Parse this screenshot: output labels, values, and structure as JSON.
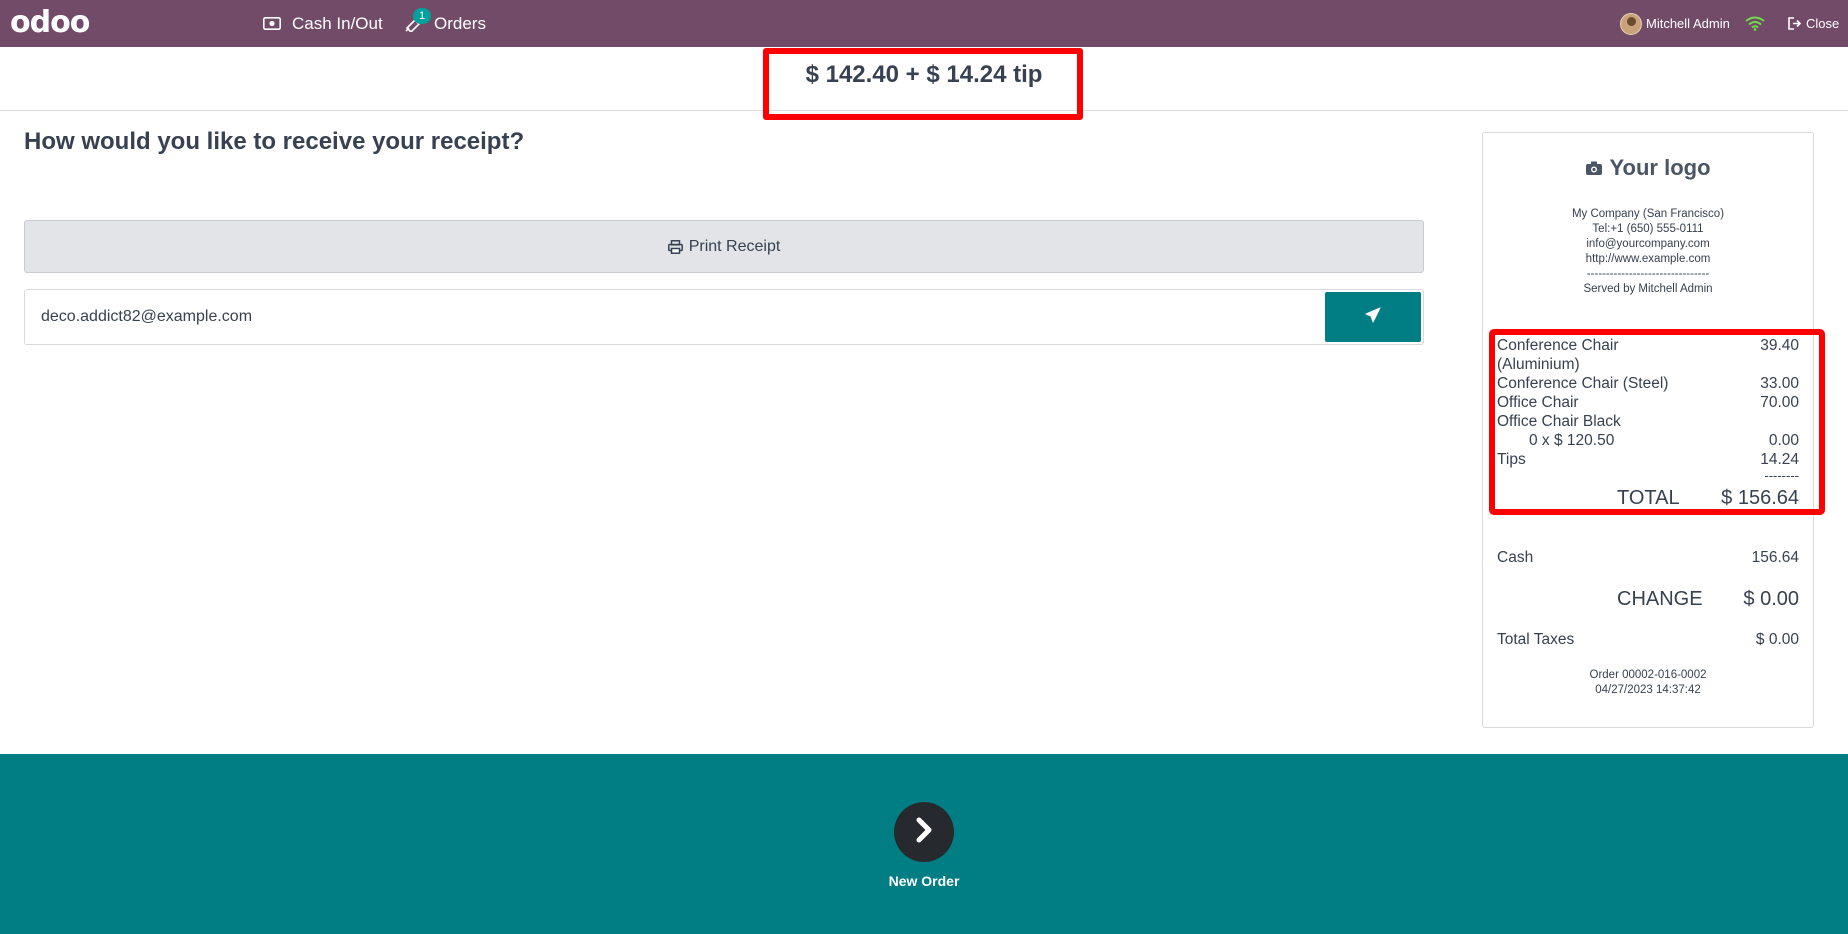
{
  "navbar": {
    "logo": "odoo",
    "cash_label": "Cash In/Out",
    "orders_label": "Orders",
    "orders_badge": "1",
    "user_name": "Mitchell Admin",
    "close_label": "Close",
    "icons": [
      "cash-icon",
      "orders-icon",
      "wifi-icon",
      "sign-out-icon"
    ]
  },
  "amount": {
    "text": "$ 142.40 + $ 14.24 tip"
  },
  "main": {
    "question": "How would you like to receive your receipt?",
    "print_label": "Print Receipt",
    "email_value": "deco.addict82@example.com"
  },
  "receipt": {
    "logo_text": "Your logo",
    "company": "My Company (San Francisco)",
    "tel": "Tel:+1 (650) 555-0111",
    "email": "info@yourcompany.com",
    "website": "http://www.example.com",
    "separator": "--------------------------------",
    "served_by": "Served by Mitchell Admin",
    "lines": [
      {
        "name": "Conference Chair",
        "price": "39.40"
      },
      {
        "name": "(Aluminium)",
        "price": ""
      },
      {
        "name": "Conference Chair (Steel)",
        "price": "33.00"
      },
      {
        "name": "Office Chair",
        "price": "70.00"
      },
      {
        "name": "Office Chair Black",
        "price": ""
      },
      {
        "name": "0 x $ 120.50",
        "price": "0.00"
      },
      {
        "name": "Tips",
        "price": "14.24"
      }
    ],
    "dash_line": "--------",
    "total_label": "TOTAL",
    "total_value": "$ 156.64",
    "cash_label": "Cash",
    "cash_value": "156.64",
    "change_label": "CHANGE",
    "change_value": "$ 0.00",
    "taxes_label": "Total Taxes",
    "taxes_value": "$ 0.00",
    "order_ref": "Order 00002-016-0002",
    "order_date": "04/27/2023 14:37:42"
  },
  "footer": {
    "new_order_label": "New Order"
  },
  "colors": {
    "navbar": "#714b67",
    "accent": "#017e84",
    "highlight": "#ff0000"
  }
}
